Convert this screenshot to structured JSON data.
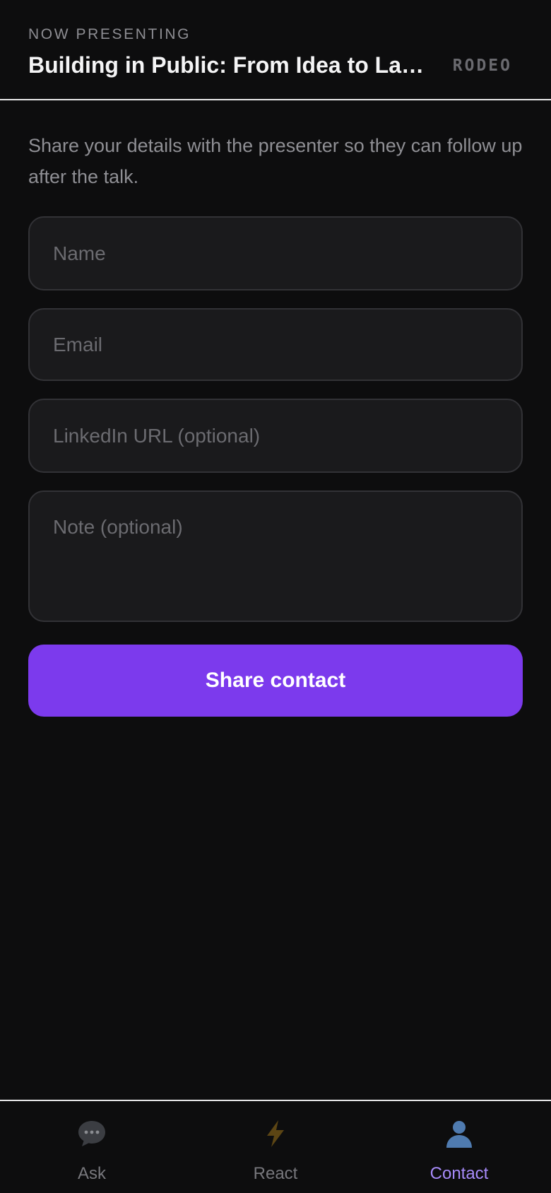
{
  "header": {
    "eyebrow": "NOW PRESENTING",
    "talk_title": "Building in Public: From Idea to Launch",
    "brand": "RODEO"
  },
  "contact_form": {
    "intro": "Share your details with the presenter so they can follow up after the talk.",
    "name_placeholder": "Name",
    "name_value": "",
    "email_placeholder": "Email",
    "email_value": "",
    "linkedin_placeholder": "LinkedIn URL (optional)",
    "linkedin_value": "",
    "note_placeholder": "Note (optional)",
    "note_value": "",
    "submit_label": "Share contact"
  },
  "bottom_nav": {
    "items": [
      {
        "label": "Ask",
        "icon": "speech-bubble-icon",
        "active": false
      },
      {
        "label": "React",
        "icon": "lightning-bolt-icon",
        "active": false
      },
      {
        "label": "Contact",
        "icon": "person-silhouette-icon",
        "active": true
      }
    ]
  },
  "colors": {
    "background": "#0d0d0e",
    "accent": "#7c3aed",
    "active_tab": "#a78bfa"
  }
}
